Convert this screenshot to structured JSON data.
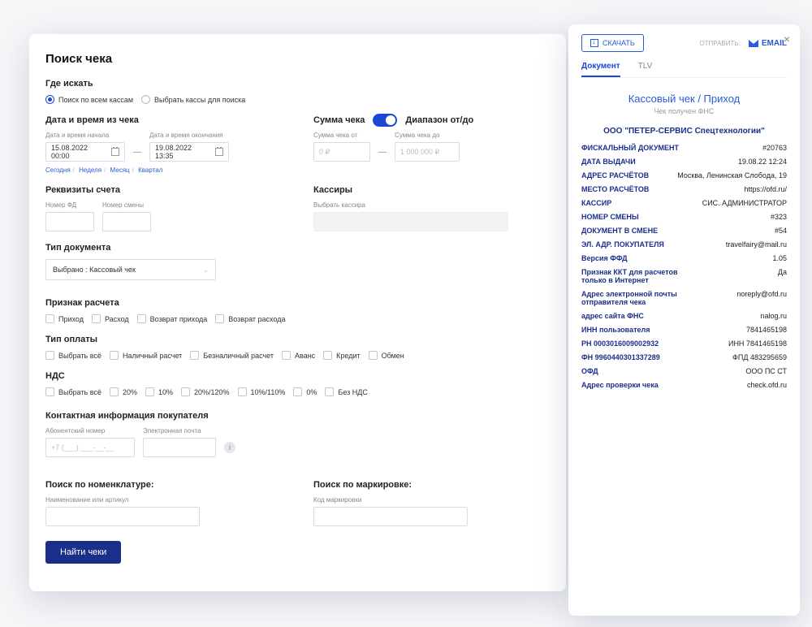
{
  "main": {
    "title": "Поиск чека",
    "where": {
      "title": "Где искать",
      "opt1": "Поиск по всем кассам",
      "opt2": "Выбрать кассы для поиска"
    },
    "datetime": {
      "title": "Дата и время из чека",
      "start_label": "Дата и время начала",
      "end_label": "Дата и время окончания",
      "start_val": "15.08.2022 00:00",
      "end_val": "19.08.2022 13:35",
      "links": {
        "today": "Сегодня",
        "week": "Неделя",
        "month": "Месяц",
        "quarter": "Квартал"
      }
    },
    "sum": {
      "title": "Сумма чека",
      "range_label": "Диапазон от/до",
      "from_label": "Сумма чека от",
      "to_label": "Сумма чека до",
      "from_ph": "0 ₽",
      "to_ph": "1 000 000 ₽"
    },
    "account": {
      "title": "Реквизиты счета",
      "fd_label": "Номер ФД",
      "shift_label": "Номер смены"
    },
    "cashiers": {
      "title": "Кассиры",
      "ph": "Выбрать кассира"
    },
    "doctype": {
      "title": "Тип документа",
      "value": "Выбрано : Кассовый чек"
    },
    "calc": {
      "title": "Признак расчета",
      "opts": [
        "Приход",
        "Расход",
        "Возврат прихода",
        "Возврат расхода"
      ]
    },
    "paytype": {
      "title": "Тип оплаты",
      "opts": [
        "Выбрать всё",
        "Наличный расчет",
        "Безналичный расчет",
        "Аванс",
        "Кредит",
        "Обмен"
      ]
    },
    "vat": {
      "title": "НДС",
      "opts": [
        "Выбрать всё",
        "20%",
        "10%",
        "20%/120%",
        "10%/110%",
        "0%",
        "Без НДС"
      ]
    },
    "contact": {
      "title": "Контактная информация покупателя",
      "phone_label": "Абонентский номер",
      "email_label": "Электронная почта",
      "phone_ph": "+7 (___) ___-__-__"
    },
    "nomen": {
      "title": "Поиск по номенклатуре:",
      "label": "Наименование или артикул"
    },
    "mark": {
      "title": "Поиск по маркировке:",
      "label": "Код маркировки"
    },
    "submit": "Найти чеки"
  },
  "side": {
    "download": "СКАЧАТЬ",
    "send_label": "ОТПРАВИТЬ:",
    "email": "EMAIL",
    "tabs": {
      "doc": "Документ",
      "tlv": "TLV"
    },
    "receipt_title": "Кассовый чек / Приход",
    "receipt_sub": "Чек получен ФНС",
    "org": "ООО \"ПЕТЕР-СЕРВИС Спецтехнологии\"",
    "rows": [
      {
        "k": "ФИСКАЛЬНЫЙ ДОКУМЕНТ",
        "v": "#20763"
      },
      {
        "k": "ДАТА ВЫДАЧИ",
        "v": "19.08.22 12:24"
      },
      {
        "k": "АДРЕС РАСЧЁТОВ",
        "v": "Москва, Ленинская Слобода, 19"
      },
      {
        "k": "МЕСТО РАСЧЁТОВ",
        "v": "https://ofd.ru/"
      },
      {
        "k": "КАССИР",
        "v": "СИС. АДМИНИСТРАТОР"
      },
      {
        "k": "НОМЕР СМЕНЫ",
        "v": "#323"
      },
      {
        "k": "ДОКУМЕНТ В СМЕНЕ",
        "v": "#54"
      },
      {
        "k": "ЭЛ. АДР. ПОКУПАТЕЛЯ",
        "v": "travelfairy@mail.ru"
      },
      {
        "k": "Версия ФФД",
        "v": "1.05"
      },
      {
        "k": "Признак ККТ для расчетов только в Интернет",
        "v": "Да"
      },
      {
        "k": "Адрес электронной почты отправителя чека",
        "v": "noreply@ofd.ru"
      },
      {
        "k": "адрес сайта ФНС",
        "v": "nalog.ru"
      },
      {
        "k": "ИНН пользователя",
        "v": "7841465198"
      },
      {
        "k": "РН 0003016009002932",
        "v": "ИНН 7841465198"
      },
      {
        "k": "ФН 9960440301337289",
        "v": "ФПД 483295659"
      },
      {
        "k": "ОФД",
        "v": "ООО ПС СТ"
      },
      {
        "k": "Адрес проверки чека",
        "v": "check.ofd.ru"
      }
    ]
  }
}
